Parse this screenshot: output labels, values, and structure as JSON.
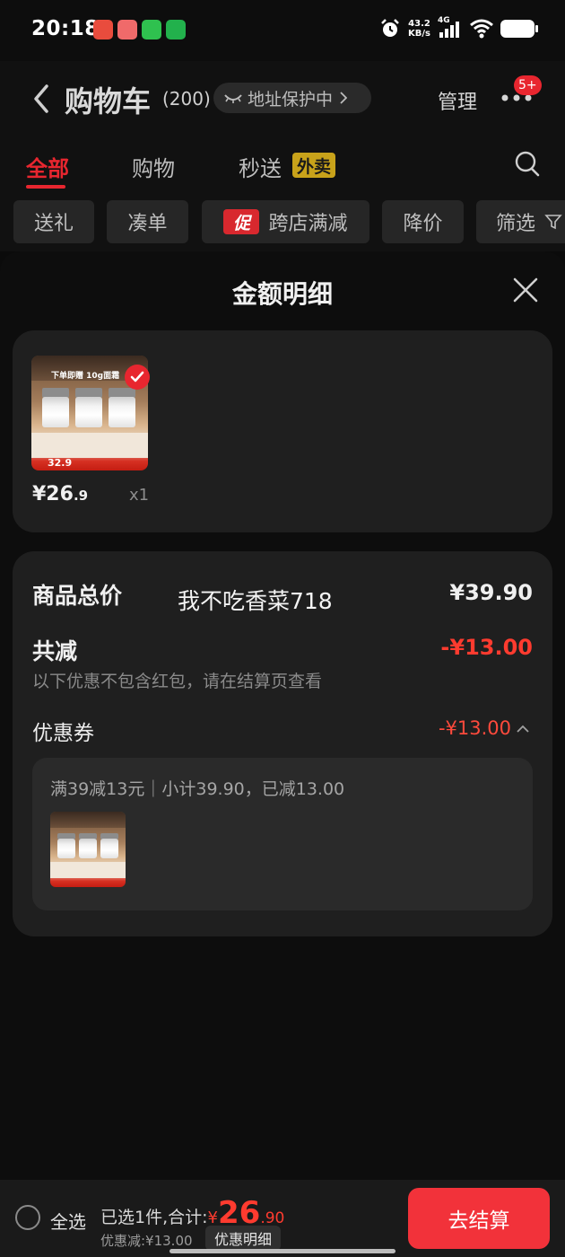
{
  "status_bar": {
    "time": "20:18",
    "net_speed": "43.2",
    "net_unit": "KB/s",
    "network": "4G"
  },
  "header": {
    "title": "购物车",
    "count": "(200)",
    "address_badge": "地址保护中",
    "manage": "管理",
    "notify_badge": "5+"
  },
  "tabs": [
    {
      "label": "全部",
      "active": true
    },
    {
      "label": "购物"
    },
    {
      "label": "秒送"
    }
  ],
  "waimai_tag": "外卖",
  "filters": {
    "gift": "送礼",
    "bundle": "凑单",
    "promo_tag": "促",
    "cross_store": "跨店满减",
    "price_drop": "降价",
    "filter": "筛选"
  },
  "sheet": {
    "title": "金额明细",
    "product": {
      "price_int": "¥26",
      "price_dec": ".9",
      "qty": "x1",
      "thumb_banner": "下单即赠 10g面霜",
      "thumb_price": "32.9"
    },
    "summary": {
      "total_label": "商品总价",
      "watermark": "我不吃香菜718",
      "total_value": "¥39.90",
      "reduce_label": "共减",
      "reduce_value": "-¥13.00",
      "note": "以下优惠不包含红包，请在结算页查看",
      "coupon_label": "优惠券",
      "coupon_value": "-¥13.00",
      "coupon_detail": "满39减13元｜小计39.90，已减13.00"
    }
  },
  "bottom_bar": {
    "select_all": "全选",
    "selected_prefix": "已选1件,合计:",
    "currency": "¥",
    "total_int": "26",
    "total_dec": ".90",
    "discount": "优惠减:¥13.00",
    "detail_button": "优惠明细",
    "checkout": "去结算"
  },
  "colors": {
    "accent": "#e8262f",
    "background": "#0b0b0b",
    "card": "#1f1f1f",
    "price_red": "#ff3b2f"
  }
}
